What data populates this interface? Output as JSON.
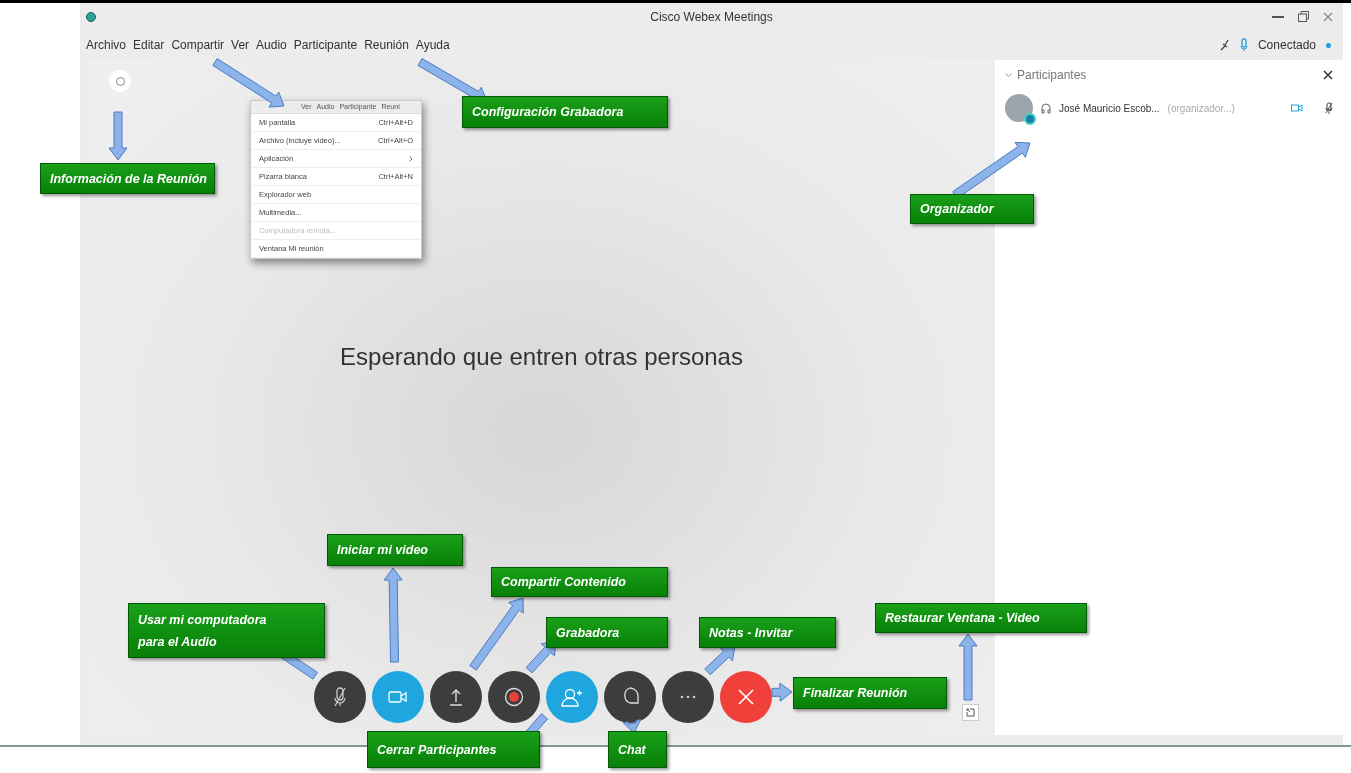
{
  "window": {
    "title": "Cisco Webex Meetings"
  },
  "menu_bar": [
    "Archivo",
    "Editar",
    "Compartir",
    "Ver",
    "Audio",
    "Participante",
    "Reunión",
    "Ayuda"
  ],
  "status": {
    "label": "Conectado"
  },
  "share_menu": {
    "header_items": [
      "Ver",
      "Audio",
      "Participante",
      "Reuni"
    ],
    "items": [
      {
        "label": "Mi pantalla",
        "shortcut": "Ctrl+Alt+D",
        "disabled": false,
        "submenu": false
      },
      {
        "label": "Archivo (incluye video)...",
        "shortcut": "Ctrl+Alt+O",
        "disabled": false,
        "submenu": false
      },
      {
        "label": "Aplicación",
        "disabled": false,
        "submenu": true
      },
      {
        "label": "Pizarra blanca",
        "shortcut": "Ctrl+Alt+N",
        "disabled": false,
        "submenu": false
      },
      {
        "label": "Explorador web",
        "disabled": false,
        "submenu": false
      },
      {
        "label": "Multimedia...",
        "disabled": false,
        "submenu": false
      },
      {
        "label": "Computadora remota...",
        "disabled": true,
        "submenu": false
      },
      {
        "label": "Ventana Mi reunión",
        "disabled": false,
        "submenu": false
      }
    ]
  },
  "stage": {
    "message": "Esperando que entren otras personas"
  },
  "participants_panel": {
    "title": "Participantes",
    "participants": [
      {
        "name": "José Mauricio Escob...",
        "role": "(organizador...)"
      }
    ]
  },
  "annotations": [
    {
      "text": "Información de la Reunión"
    },
    {
      "text": "Configuración Grabadora"
    },
    {
      "text": "Organizador"
    },
    {
      "text": "Iniciar mi video"
    },
    {
      "text": "Compartir Contenido"
    },
    {
      "text": "Usar mi computadora para el Audio"
    },
    {
      "text": "Grabadora"
    },
    {
      "text": "Notas - Invitar"
    },
    {
      "text": "Restaurar Ventana - Video"
    },
    {
      "text": "Finalizar Reunión"
    },
    {
      "text": "Cerrar Participantes"
    },
    {
      "text": "Chat"
    }
  ]
}
